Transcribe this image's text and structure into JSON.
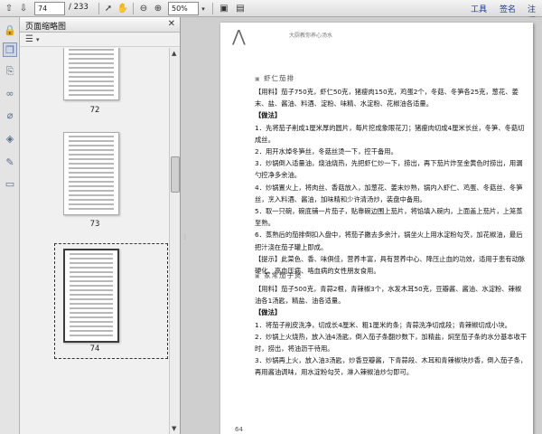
{
  "toolbar": {
    "page_current": "74",
    "page_total": "/ 233",
    "zoom": "50%",
    "tools_label": "工具",
    "sign_label": "签名",
    "comment_label": "注释"
  },
  "panel": {
    "title": "页面缩略图",
    "thumbnails": [
      {
        "label": "72"
      },
      {
        "label": "73"
      },
      {
        "label": "74"
      }
    ]
  },
  "document": {
    "header": "大厨教你养心汤水",
    "section1_title": "虾仁茄排",
    "section1": [
      "【用料】茄子750克，虾仁50克，猪瘦肉150克，鸡蛋2个，冬菇、冬笋各25克，葱花、姜末、盐、酱油、料酒、淀粉、味精、水淀粉、花椒油各适量。",
      "【做法】",
      "1．先将茄子削成1厘米厚的圆片，每片挖成象眼花刀；猪瘦肉切成4厘米长丝，冬笋、冬菇切成丝。",
      "2．用开水焯冬笋丝，冬菇丝烫一下，控干备用。",
      "3．炒锅倒入适量油，烧油烧热，先把虾仁炒一下，捞出，再下茄片炸至金黄色时捞出，用漏勺控净多余油。",
      "4．炒锅置火上，将肉丝、香菇放入，加葱花、姜末炒熟，锅内入虾仁、鸡蛋、冬菇丝、冬笋丝，烹入料酒、酱油，加味精和少许清汤炒，装盘中备用。",
      "5．取一只碗，碗底铺一片茄子，贴靠碗边围上茄片，将馅填入碗内，上面盖上茄片，上笼蒸至熟。",
      "6．蒸熟后的茄排倒扣入盘中，将茄子撇去多余汁，锅坐火上用水淀粉勾芡，加花椒油，最后把汁浇在茄子罐上即成。",
      "【提示】此菜色、香、味俱佳，营养丰富，具有营养中心、降压止血的功效，适用于患有动脉硬化、高血压病、咯血病的女性朋友食用。"
    ],
    "section2_title": "家常茄子煲",
    "section2": [
      "【用料】茄子500克，青蒜2根，青辣椒3个，水发木耳50克，豆瓣酱、酱油、水淀粉、辣椒油各1汤匙，精盐、油各适量。",
      "【做法】",
      "1．将茄子削皮洗净，切成长4厘米、粗1厘米的条；青蒜洗净切成段；青辣椒切成小块。",
      "2．炒锅上火烧热，放入油4汤匙，倒入茄子条翻炒数下，加精盐，焖至茄子条的水分基本收干时，捞出，将油沥干待用。",
      "3．炒锅再上火，放入油3汤匙，炒香豆瓣酱，下青蒜段、木耳和青辣椒块炒香，倒入茄子条，再用酱油调味，用水淀粉勾芡，淋入辣椒油炒匀即可。"
    ],
    "page_number": "64"
  }
}
